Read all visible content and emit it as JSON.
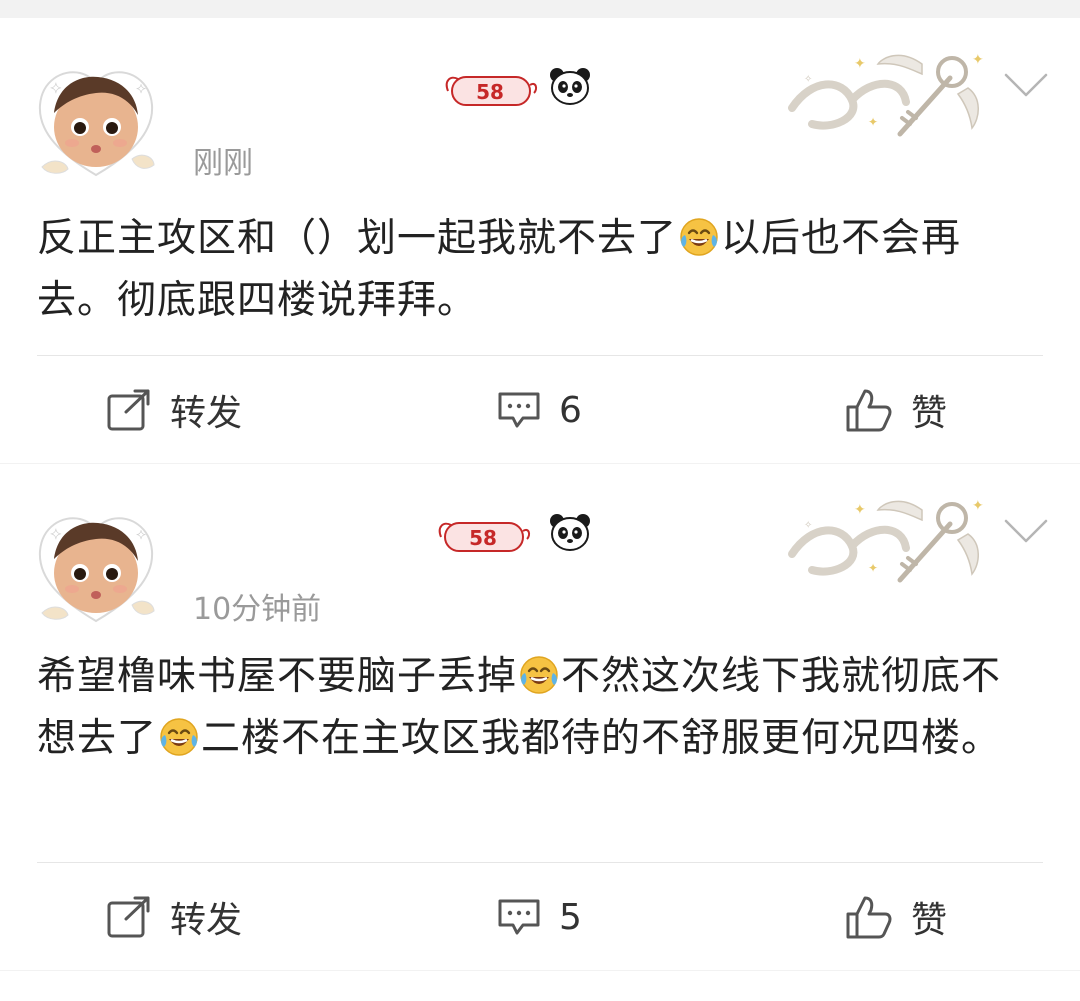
{
  "posts": [
    {
      "badge_level": "58",
      "time": "刚刚",
      "text": [
        {
          "t": "反正主攻区和（）划一起我就不去了"
        },
        {
          "emoji": "laughing-tears-emoji"
        },
        {
          "t": "以后也不会再去。彻底跟四楼说拜拜。"
        }
      ],
      "actions": {
        "repost": "转发",
        "comment_count": "6",
        "like": "赞"
      }
    },
    {
      "badge_level": "58",
      "time": "10分钟前",
      "text": [
        {
          "t": "希望橹味书屋不要脑子丢掉"
        },
        {
          "emoji": "laughing-tears-emoji"
        },
        {
          "t": "不然这次线下我就彻底不想去了"
        },
        {
          "emoji": "laughing-tears-emoji"
        },
        {
          "t": "二楼不在主攻区我都待的不舒服更何况四楼。"
        }
      ],
      "actions": {
        "repost": "转发",
        "comment_count": "5",
        "like": "赞"
      }
    }
  ],
  "icons": {
    "repost": "repost-icon",
    "comment": "comment-icon",
    "like": "thumbs-up-icon",
    "more": "chevron-down-icon",
    "panda": "panda-emoji-icon"
  },
  "colors": {
    "text": "#222222",
    "meta": "#9a9a9a",
    "badge": "#c62828",
    "background": "#f2f2f2",
    "card": "#ffffff"
  }
}
